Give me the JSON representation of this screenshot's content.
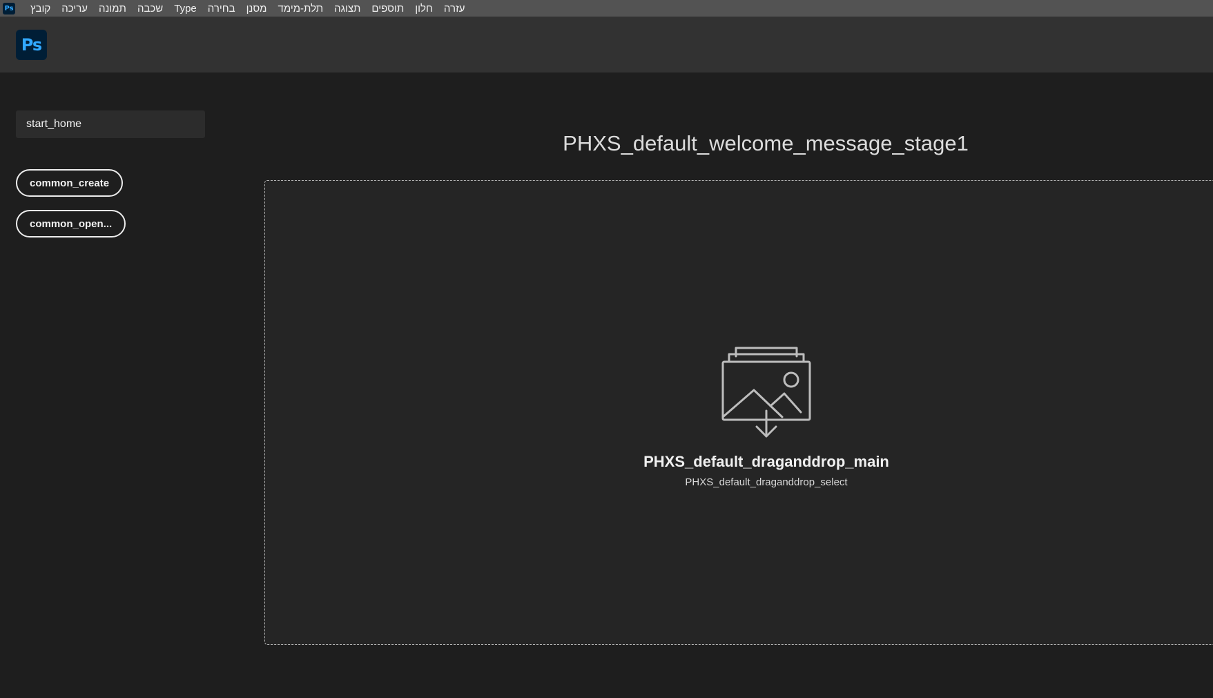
{
  "app": {
    "logo_text": "Ps",
    "mini_logo_text": "Ps"
  },
  "menubar": {
    "items": [
      "קובץ",
      "עריכה",
      "תמונה",
      "שכבה",
      "Type",
      "בחירה",
      "מסנן",
      "תלת-מימד",
      "תצוגה",
      "תוספים",
      "חלון",
      "עזרה"
    ]
  },
  "sidebar": {
    "home_label": "start_home",
    "create_label": "common_create",
    "open_label": "common_open..."
  },
  "main": {
    "welcome_message": "PHXS_default_welcome_message_stage1",
    "drop_main": "PHXS_default_draganddrop_main",
    "drop_select": "PHXS_default_draganddrop_select"
  },
  "icons": {
    "app_logo": "photoshop-logo-icon",
    "drop": "image-import-icon"
  },
  "colors": {
    "accent": "#31a8ff",
    "logo_bg": "#001e36",
    "menubar_bg": "#535353",
    "header_bg": "#323232",
    "page_bg": "#1e1e1e"
  }
}
